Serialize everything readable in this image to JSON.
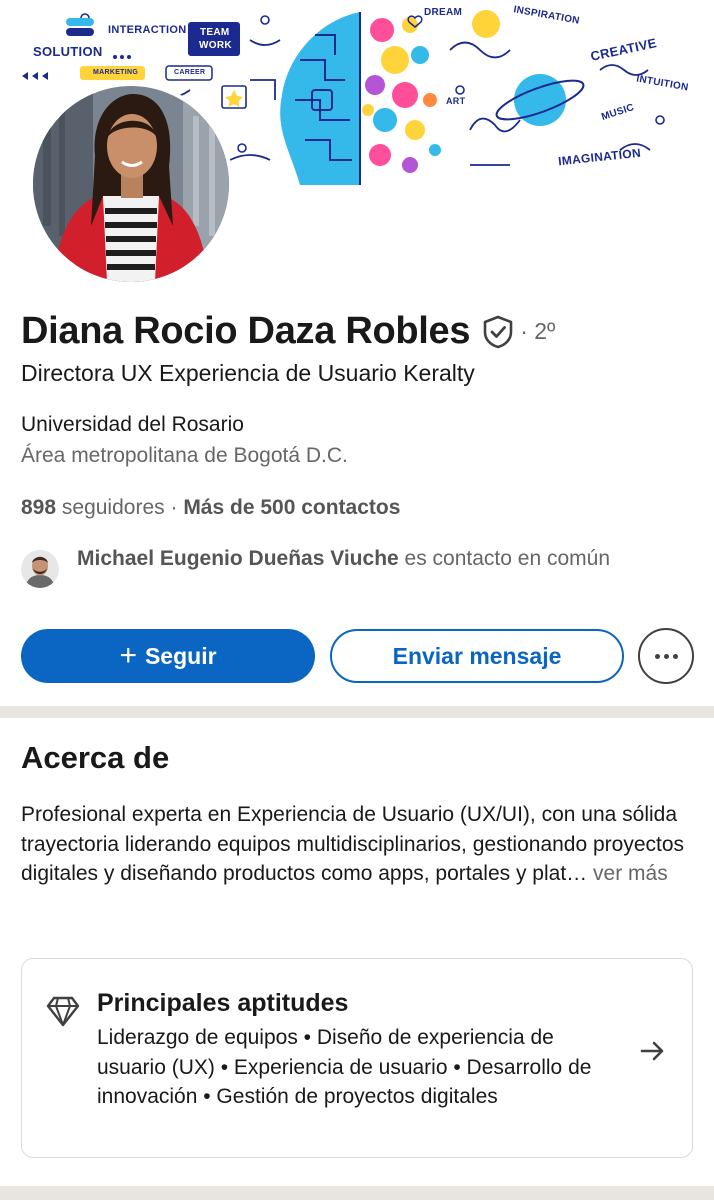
{
  "banner": {
    "words": [
      "SOLUTION",
      "INTERACTION",
      "TEAM",
      "WORK",
      "MARKETING",
      "CAREER",
      "DREAM",
      "INSPIRATION",
      "CREATIVE",
      "INTUITION",
      "ART",
      "MUSIC",
      "IMAGINATION"
    ]
  },
  "profile": {
    "name": "Diana Rocio Daza Robles",
    "degree": "· 2º",
    "headline": "Directora UX Experiencia de Usuario Keralty",
    "school": "Universidad del Rosario",
    "location": "Área metropolitana de Bogotá D.C.",
    "followers_count": "898",
    "followers_label": "seguidores",
    "separator": "·",
    "connections": "Más de 500 contactos"
  },
  "mutual": {
    "name": "Michael Eugenio Dueñas Viuche",
    "suffix": "es contacto en común"
  },
  "actions": {
    "follow_plus": "+",
    "follow_label": "Seguir",
    "message_label": "Enviar mensaje"
  },
  "about": {
    "title": "Acerca de",
    "text": "Profesional experta en Experiencia de Usuario (UX/UI), con una sólida trayectoria liderando equipos multidisciplinarios, gestionando proyectos digitales y diseñando productos como apps, portales y plat…",
    "see_more": "ver más"
  },
  "skills": {
    "title": "Principales aptitudes",
    "text": "Liderazgo de equipos • Diseño de experiencia de usuario (UX) • Experiencia de usuario • Desarrollo de innovación • Gestión de proyectos digitales"
  },
  "colors": {
    "brand_blue": "#0a66c2",
    "text_primary": "#191919",
    "text_secondary": "#666666",
    "divider": "#e8e5e0",
    "banner_navy": "#1b2a8f"
  },
  "icons": [
    "verified-shield-icon",
    "plus-icon",
    "more-options-icon",
    "diamond-icon",
    "arrow-right-icon",
    "star-icon",
    "heart-icon"
  ]
}
